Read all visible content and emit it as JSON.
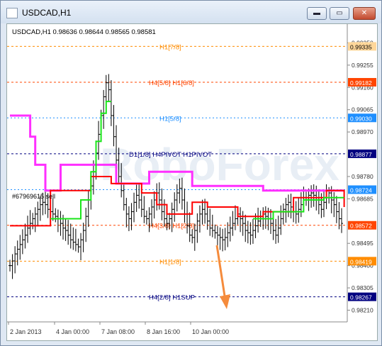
{
  "window": {
    "title": "USDCAD,H1",
    "minimize_glyph": "▬",
    "maximize_glyph": "▭",
    "close_glyph": "✕"
  },
  "chart_info": "USDCAD,H1  0.98636 0.98644 0.98565 0.98581",
  "watermark": "RoboForex",
  "order_label": "#67969615 sell",
  "colors": {
    "magenta": "#ff2fff",
    "red": "#ff0000",
    "green": "#19e619",
    "orange": "#ff8c00",
    "arrow": "#f58b3c"
  },
  "levels": [
    {
      "label": "H1[7/8]",
      "price": 0.99335,
      "tag": "0.99335",
      "color": "#ff8c00",
      "tagbg": "#ffd79a",
      "tagfg": "#000000",
      "dash": "3,3",
      "labelx": 215
    },
    {
      "label": "H4[5/8] H1[6/8]",
      "price": 0.99182,
      "tag": "0.99182",
      "color": "#ff4500",
      "tagbg": "#ff4500",
      "tagfg": "#ffffff",
      "dash": "3,3",
      "labelx": 200
    },
    {
      "label": "H1[5/8]",
      "price": 0.9903,
      "tag": "0.99030",
      "color": "#1e8fff",
      "tagbg": "#1e8fff",
      "tagfg": "#ffffff",
      "dash": "2,3",
      "labelx": 215
    },
    {
      "label": "D1[1/8] H4PIVOT H1PIVOT",
      "price": 0.98877,
      "tag": "0.98877",
      "color": "#000080",
      "tagbg": "#000080",
      "tagfg": "#ffffff",
      "dash": "3,3",
      "labelx": 172
    },
    {
      "label": "",
      "price": 0.98724,
      "tag": "0.98724",
      "color": "#1e8fff",
      "tagbg": "#1e8fff",
      "tagfg": "#ffffff",
      "dash": "2,3",
      "labelx": 215
    },
    {
      "label": "H4[3/8] H1[2/8]",
      "price": 0.98572,
      "tag": "0.98572",
      "color": "#ff4500",
      "tagbg": "#ff4500",
      "tagfg": "#ffffff",
      "dash": "3,3",
      "labelx": 200
    },
    {
      "label": "H1[1/8]",
      "price": 0.98419,
      "tag": "0.98419",
      "color": "#ff8c00",
      "tagbg": "#ff8c00",
      "tagfg": "#ffffff",
      "dash": "3,3",
      "labelx": 215
    },
    {
      "label": "H4[2/8] H1SUP",
      "price": 0.98267,
      "tag": "0.98267",
      "color": "#000080",
      "tagbg": "#000080",
      "tagfg": "#ffffff",
      "dash": "3,3",
      "labelx": 200
    }
  ],
  "price_ticks": [
    "0.99350",
    "0.99255",
    "0.99160",
    "0.99065",
    "0.98970",
    "0.98780",
    "0.98685",
    "0.98495",
    "0.98400",
    "0.98305",
    "0.98210"
  ],
  "time_ticks": [
    "2 Jan 2013",
    "4 Jan 00:00",
    "7 Jan 08:00",
    "8 Jan 16:00",
    "10 Jan 00:00"
  ],
  "chart_data": {
    "type": "bar",
    "symbol": "USDCAD",
    "timeframe": "H1",
    "ylim": [
      0.9816,
      0.9943
    ],
    "last_ohlc": {
      "open": 0.98636,
      "high": 0.98644,
      "low": 0.98565,
      "close": 0.98581
    },
    "price_series": [
      0.984,
      0.9842,
      0.9845,
      0.9847,
      0.9849,
      0.9851,
      0.9853,
      0.9856,
      0.9858,
      0.986,
      0.9862,
      0.9864,
      0.9866,
      0.9867,
      0.9866,
      0.9864,
      0.9863,
      0.9862,
      0.9861,
      0.986,
      0.9858,
      0.9856,
      0.9855,
      0.9853,
      0.9851,
      0.985,
      0.9849,
      0.9848,
      0.9851,
      0.9855,
      0.9861,
      0.9868,
      0.9874,
      0.988,
      0.9888,
      0.9896,
      0.9904,
      0.9912,
      0.9918,
      0.9915,
      0.9904,
      0.9895,
      0.9885,
      0.9878,
      0.9872,
      0.9866,
      0.9862,
      0.986,
      0.9863,
      0.9867,
      0.987,
      0.9868,
      0.9864,
      0.9861,
      0.986,
      0.9862,
      0.9865,
      0.9868,
      0.9871,
      0.9868,
      0.9863,
      0.986,
      0.9858,
      0.986,
      0.9864,
      0.9868,
      0.9871,
      0.9873,
      0.9868,
      0.9862,
      0.9857,
      0.9853,
      0.9852,
      0.9855,
      0.9859,
      0.9862,
      0.9864,
      0.9862,
      0.9859,
      0.9856,
      0.9855,
      0.9854,
      0.9853,
      0.9852,
      0.9851,
      0.9852,
      0.9854,
      0.9856,
      0.9858,
      0.986,
      0.9862,
      0.986,
      0.9858,
      0.9855,
      0.9854,
      0.9853,
      0.9855,
      0.9857,
      0.9859,
      0.9861,
      0.9862,
      0.9861,
      0.986,
      0.9858,
      0.9855,
      0.9853,
      0.9856,
      0.986,
      0.9864,
      0.9866,
      0.9867,
      0.9865,
      0.9863,
      0.9862,
      0.9864,
      0.9866,
      0.9868,
      0.9869,
      0.987,
      0.9871,
      0.987,
      0.9868,
      0.9866,
      0.9864,
      0.9867,
      0.9869,
      0.9871,
      0.9868,
      0.9866,
      0.9863,
      0.986,
      0.9858
    ],
    "series": [
      {
        "name": "magenta",
        "color": "#ff2fff",
        "points": [
          [
            0,
            0.9904
          ],
          [
            8,
            0.9904
          ],
          [
            8,
            0.9895
          ],
          [
            10,
            0.9895
          ],
          [
            10,
            0.9883
          ],
          [
            14,
            0.9883
          ],
          [
            14,
            0.9872
          ],
          [
            20,
            0.9872
          ],
          [
            20,
            0.9883
          ],
          [
            42,
            0.9883
          ],
          [
            42,
            0.9875
          ],
          [
            55,
            0.9875
          ],
          [
            55,
            0.988
          ],
          [
            72,
            0.988
          ],
          [
            72,
            0.9874
          ],
          [
            100,
            0.9874
          ],
          [
            100,
            0.9872
          ],
          [
            132,
            0.9872
          ]
        ]
      },
      {
        "name": "red",
        "color": "#ff0000",
        "points": [
          [
            0,
            0.9857
          ],
          [
            16,
            0.9857
          ],
          [
            16,
            0.9872
          ],
          [
            32,
            0.9872
          ],
          [
            32,
            0.9878
          ],
          [
            40,
            0.9878
          ],
          [
            40,
            0.9875
          ],
          [
            52,
            0.9875
          ],
          [
            52,
            0.9871
          ],
          [
            58,
            0.9871
          ],
          [
            58,
            0.9866
          ],
          [
            62,
            0.9866
          ],
          [
            62,
            0.9862
          ],
          [
            72,
            0.9862
          ],
          [
            72,
            0.9867
          ],
          [
            78,
            0.9867
          ],
          [
            78,
            0.9865
          ],
          [
            90,
            0.9865
          ],
          [
            90,
            0.9861
          ],
          [
            100,
            0.9861
          ],
          [
            100,
            0.9863
          ],
          [
            112,
            0.9863
          ],
          [
            112,
            0.9869
          ],
          [
            125,
            0.9869
          ],
          [
            125,
            0.9872
          ],
          [
            132,
            0.9872
          ],
          [
            132,
            0.9865
          ]
        ]
      },
      {
        "name": "green",
        "color": "#19e619",
        "points": [
          [
            16,
            0.986
          ],
          [
            28,
            0.986
          ],
          [
            28,
            0.9868
          ],
          [
            32,
            0.9868
          ],
          [
            32,
            0.988
          ],
          [
            34,
            0.988
          ],
          [
            34,
            0.9893
          ],
          [
            36,
            0.9893
          ],
          [
            36,
            0.9905
          ],
          [
            38,
            0.9905
          ],
          [
            38,
            0.991
          ],
          [
            40,
            0.991
          ]
        ]
      },
      {
        "name": "green",
        "color": "#19e619",
        "points": [
          [
            96,
            0.986
          ],
          [
            104,
            0.986
          ],
          [
            104,
            0.9863
          ],
          [
            116,
            0.9863
          ],
          [
            116,
            0.9868
          ],
          [
            124,
            0.9868
          ],
          [
            124,
            0.9869
          ],
          [
            132,
            0.9869
          ]
        ]
      }
    ]
  }
}
